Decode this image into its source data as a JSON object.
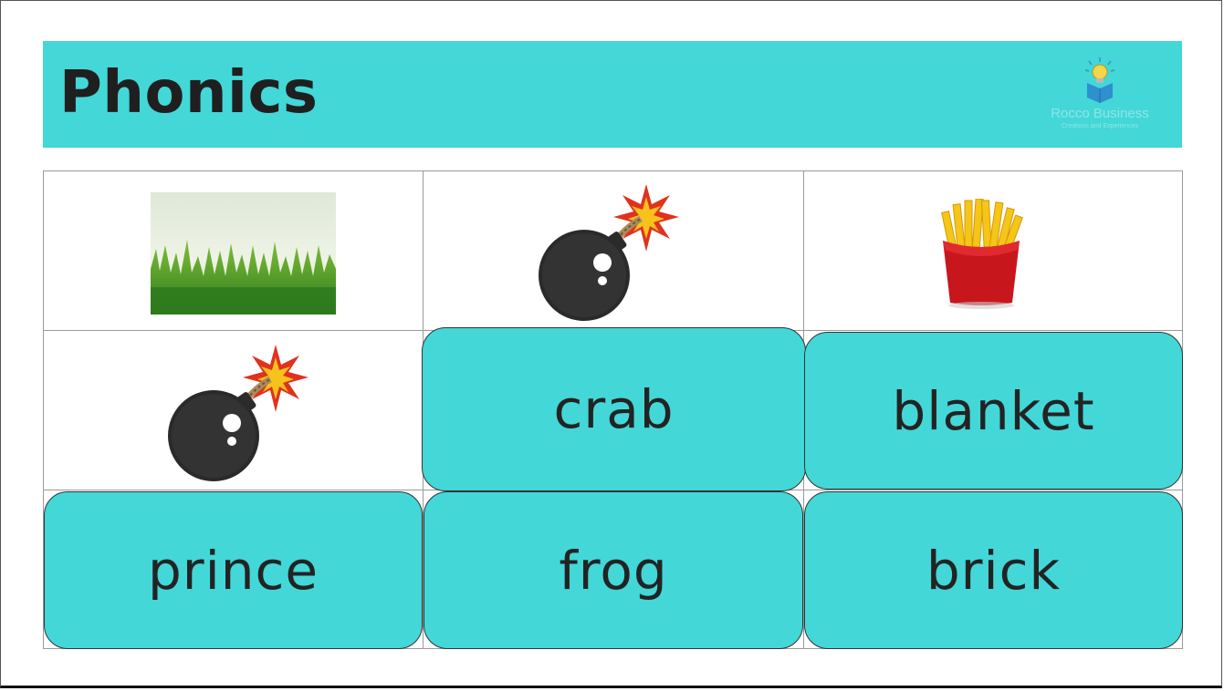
{
  "header": {
    "title": "Phonics",
    "logo_name": "Rocco Business",
    "logo_sub": "Creations and Experiences"
  },
  "pictures": [
    {
      "icon": "grass-picture",
      "row": 1,
      "col": 1
    },
    {
      "icon": "bomb-icon",
      "row": 1,
      "col": 2
    },
    {
      "icon": "french-fries-icon",
      "row": 1,
      "col": 3
    },
    {
      "icon": "bomb-icon",
      "row": 2,
      "col": 1
    }
  ],
  "word_cards": {
    "crab": "crab",
    "blanket": "blanket",
    "prince": "prince",
    "frog": "frog",
    "brick": "brick"
  },
  "colors": {
    "accent": "#43d7d8",
    "text": "#232323"
  }
}
